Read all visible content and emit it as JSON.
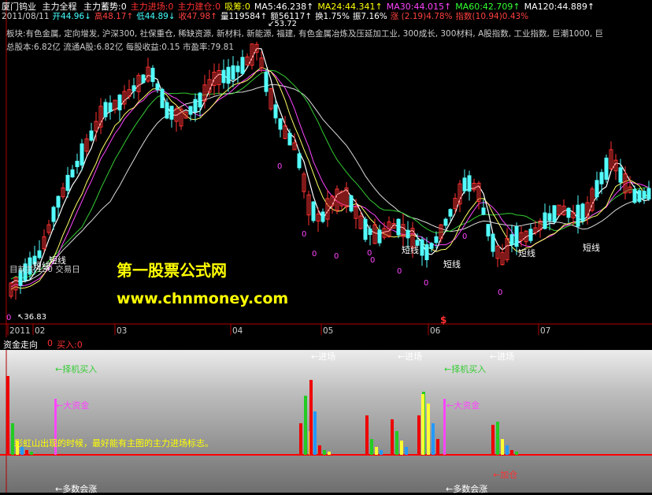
{
  "header": {
    "stock_name": "厦门钨业",
    "indicator_name": "主力全程",
    "params": [
      {
        "text": "主力蓄势:0",
        "color": "#ffffff"
      },
      {
        "text": "主力进场:0",
        "color": "#ff3030"
      },
      {
        "text": "主力建仓:0",
        "color": "#ff3030"
      },
      {
        "text": "吸筹:0",
        "color": "#ffff00"
      },
      {
        "text": "MA5:46.238↑",
        "color": "#ffffff"
      },
      {
        "text": "MA24:44.341↑",
        "color": "#ffff00"
      },
      {
        "text": "MA30:44.015↑",
        "color": "#ff44ff"
      },
      {
        "text": "MA60:42.709↑",
        "color": "#33ff33"
      },
      {
        "text": "MA120:44.889↑",
        "color": "#ffffff"
      }
    ]
  },
  "quote": [
    {
      "text": "2011/08/11",
      "color": "#cccccc"
    },
    {
      "text": "开44.96↓",
      "color": "#44ffff"
    },
    {
      "text": "高48.17↑",
      "color": "#ff4040"
    },
    {
      "text": "低44.89↓",
      "color": "#44ffff"
    },
    {
      "text": "收47.98↑",
      "color": "#ff4040"
    },
    {
      "text": "量119584↑",
      "color": "#ffffff"
    },
    {
      "text": "额56117↑",
      "color": "#ffffff"
    },
    {
      "text": "换1.75%",
      "color": "#ffffff"
    },
    {
      "text": "振7.16%",
      "color": "#ffffff"
    },
    {
      "text": "涨 (2.19)4.78%",
      "color": "#ff4040"
    },
    {
      "text": "指数(10.94)0.43%",
      "color": "#ff4040"
    }
  ],
  "info": {
    "sector": "板块:有色金属, 定向增发, 沪深300, 社保重仓, 稀缺资源, 新材料, 新能源, 福建, 有色金属冶炼及压延加工业, 300成长, 300材料, A股指数, 工业指数, 巨潮1000, 巨",
    "capital": "总股本:6.82亿  流通A股:6.82亿     每股收益:0.15  市盈率:79.81"
  },
  "price_labels": {
    "high": "53.72",
    "low": "36.83"
  },
  "chart_overlay": {
    "trade_days": "目前共 130 交易日"
  },
  "date_axis": [
    "2011",
    "02",
    "03",
    "04",
    "05",
    "06",
    "07"
  ],
  "marker_s": "$",
  "zero_label": "0",
  "short_line_label": "短线",
  "watermark": {
    "title": "第一股票公式网",
    "url": "www.chnmoney.com"
  },
  "indicator_header": {
    "name": "资金走向",
    "value": "0",
    "buy": "买入:0"
  },
  "annotations": {
    "enter": "←进场",
    "pick_buy": "←择机买入",
    "big_money": "←大资金",
    "rainbow": "彩虹山出现的时候，最好能有主图的主力进场标志。",
    "add_pos": "←加仓",
    "multi_rise": "←多数会涨"
  },
  "colors": {
    "up": "#ff3232",
    "down": "#54ffff",
    "ma5": "#ffffff",
    "ma24": "#ffff66",
    "ma30": "#ff44ff",
    "ma60": "#33cc33",
    "ma120": "#dddddd",
    "grid_red": "#b00000"
  }
}
